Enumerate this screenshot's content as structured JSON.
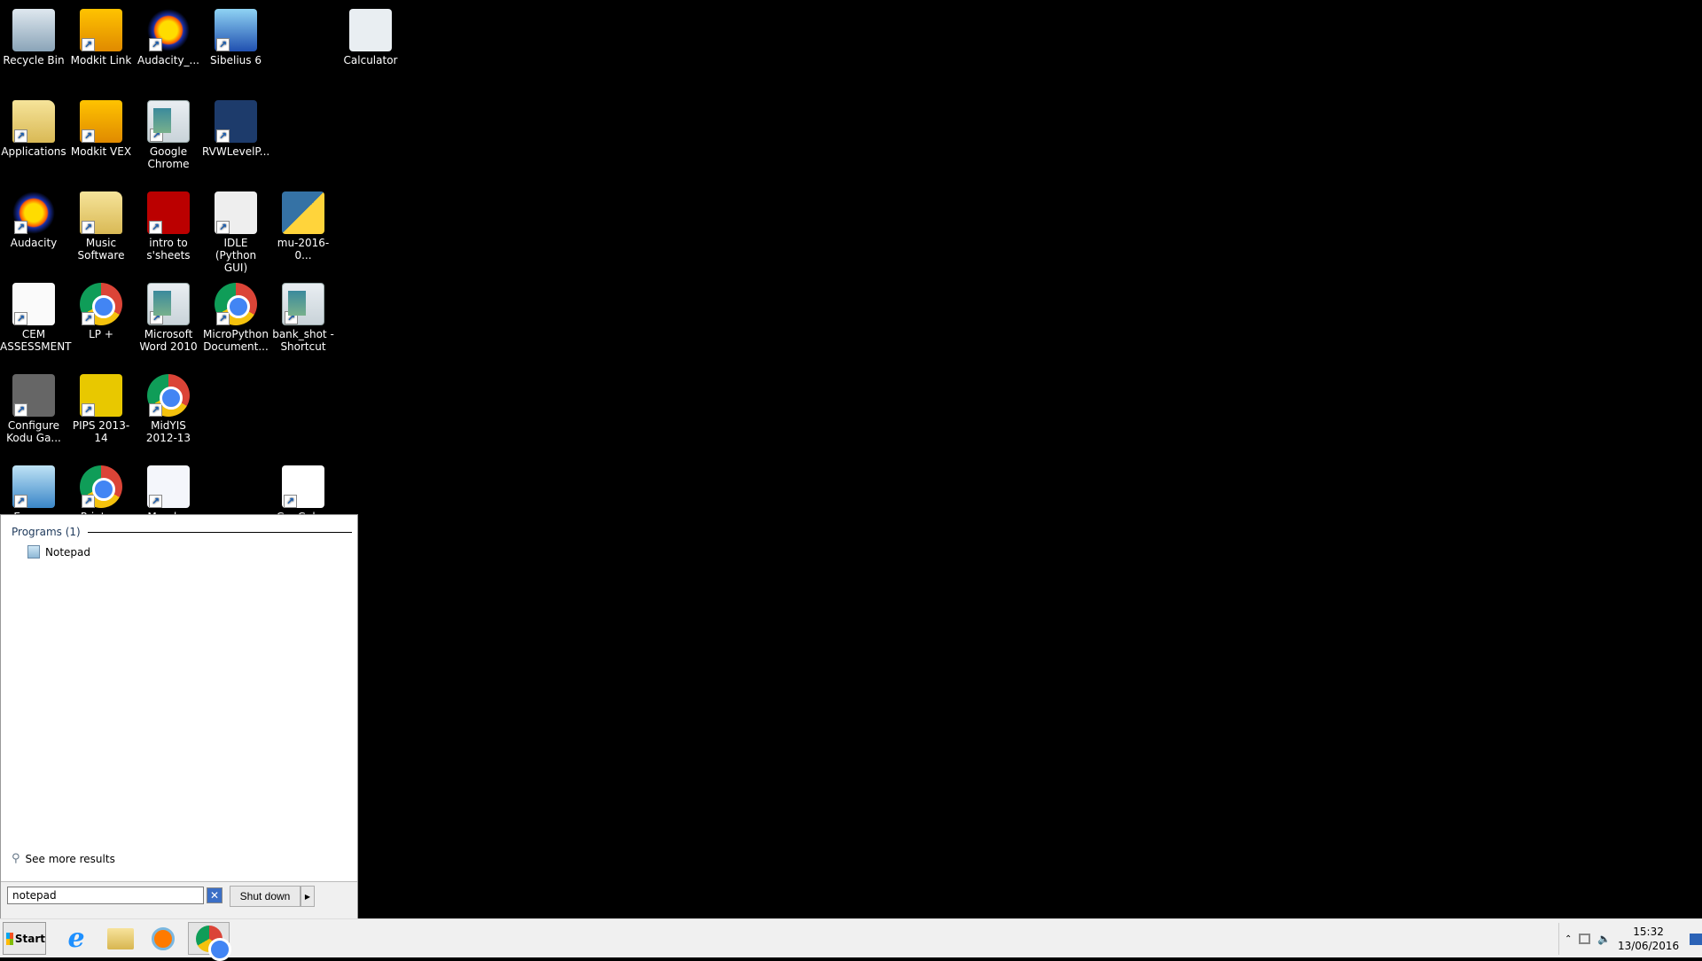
{
  "desktop": {
    "icons": [
      {
        "label": "Recycle Bin",
        "icon": "recycle-bin-icon"
      },
      {
        "label": "Modkit Link",
        "icon": "modkit-icon"
      },
      {
        "label": "Audacity_...",
        "icon": "audacity-icon"
      },
      {
        "label": "Sibelius 6",
        "icon": "sibelius-icon"
      },
      {
        "label": "Calculator",
        "icon": "calculator-icon"
      },
      {
        "label": "Applications",
        "icon": "folder-icon"
      },
      {
        "label": "Modkit VEX",
        "icon": "modkit-icon"
      },
      {
        "label": "Google Chrome",
        "icon": "window-icon"
      },
      {
        "label": "RVWLevelP...",
        "icon": "rvw-icon"
      },
      {
        "label": "Audacity",
        "icon": "audacity-icon"
      },
      {
        "label": "Music Software",
        "icon": "folder-icon"
      },
      {
        "label": "intro to s'sheets",
        "icon": "powerpoint-icon"
      },
      {
        "label": "IDLE (Python GUI)",
        "icon": "idle-icon"
      },
      {
        "label": "mu-2016-0...",
        "icon": "python-icon"
      },
      {
        "label": "CEM ASSESSMENT",
        "icon": "blank-document-icon"
      },
      {
        "label": "LP +",
        "icon": "chrome-icon"
      },
      {
        "label": "Microsoft Word 2010",
        "icon": "window-icon"
      },
      {
        "label": "MicroPython Document...",
        "icon": "chrome-icon"
      },
      {
        "label": "bank_shot - Shortcut",
        "icon": "window-icon"
      },
      {
        "label": "Configure Kodu Ga...",
        "icon": "kodu-icon"
      },
      {
        "label": "PIPS 2013-14",
        "icon": "pips-icon"
      },
      {
        "label": "MidYIS 2012-13",
        "icon": "chrome-icon"
      },
      {
        "label": "Engage",
        "icon": "engage-icon"
      },
      {
        "label": "Printers",
        "icon": "chrome-icon"
      },
      {
        "label": "Monday",
        "icon": "word-document-icon"
      },
      {
        "label": "GeoGebra",
        "icon": "geogebra-icon"
      }
    ]
  },
  "start_menu": {
    "group_header": "Programs (1)",
    "results": [
      {
        "label": "Notepad",
        "icon": "notepad-icon"
      }
    ],
    "see_more": "See more results",
    "search_value": "notepad",
    "shutdown_label": "Shut down"
  },
  "taskbar": {
    "start_label": "Start",
    "pinned": [
      "internet-explorer-icon",
      "file-explorer-icon",
      "media-player-icon",
      "chrome-icon"
    ],
    "time": "15:32",
    "date": "13/06/2016"
  }
}
